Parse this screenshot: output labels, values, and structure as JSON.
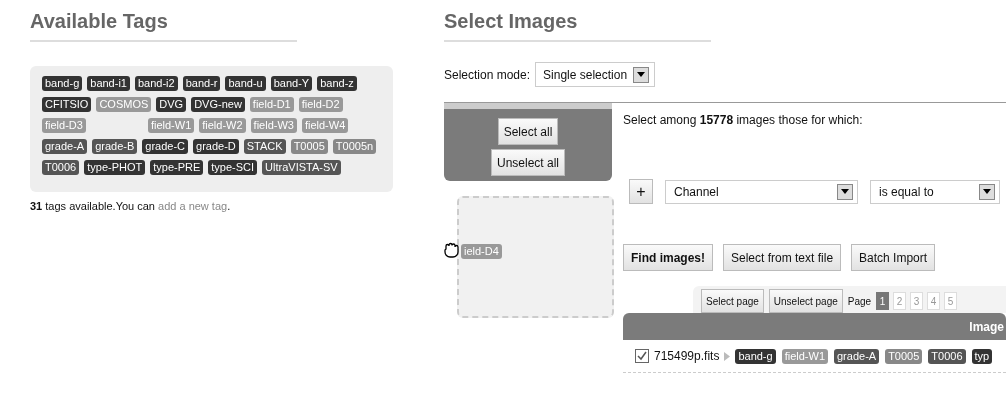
{
  "tags_panel": {
    "title": "Available Tags",
    "tags": [
      {
        "kind": "tag",
        "label": "band-g",
        "color": "#333333"
      },
      {
        "kind": "tag",
        "label": "band-i1",
        "color": "#333333"
      },
      {
        "kind": "tag",
        "label": "band-i2",
        "color": "#333333"
      },
      {
        "kind": "tag",
        "label": "band-r",
        "color": "#333333"
      },
      {
        "kind": "tag",
        "label": "band-u",
        "color": "#333333"
      },
      {
        "kind": "tag",
        "label": "band-Y",
        "color": "#333333"
      },
      {
        "kind": "tag",
        "label": "band-z",
        "color": "#333333"
      },
      {
        "kind": "tag",
        "label": "CFITSIO",
        "color": "#333333"
      },
      {
        "kind": "tag",
        "label": "COSMOS",
        "color": "#999999"
      },
      {
        "kind": "tag",
        "label": "DVG",
        "color": "#333333"
      },
      {
        "kind": "tag",
        "label": "DVG-new",
        "color": "#333333"
      },
      {
        "kind": "tag",
        "label": "field-D1",
        "color": "#999999"
      },
      {
        "kind": "tag",
        "label": "field-D2",
        "color": "#999999"
      },
      {
        "kind": "tag",
        "label": "field-D3",
        "color": "#999999"
      },
      {
        "kind": "gap"
      },
      {
        "kind": "tag",
        "label": "field-W1",
        "color": "#999999"
      },
      {
        "kind": "tag",
        "label": "field-W2",
        "color": "#999999"
      },
      {
        "kind": "tag",
        "label": "field-W3",
        "color": "#999999"
      },
      {
        "kind": "tag",
        "label": "field-W4",
        "color": "#999999"
      },
      {
        "kind": "tag",
        "label": "grade-A",
        "color": "#555555"
      },
      {
        "kind": "tag",
        "label": "grade-B",
        "color": "#555555"
      },
      {
        "kind": "tag",
        "label": "grade-C",
        "color": "#333333"
      },
      {
        "kind": "tag",
        "label": "grade-D",
        "color": "#333333"
      },
      {
        "kind": "tag",
        "label": "STACK",
        "color": "#555555"
      },
      {
        "kind": "tag",
        "label": "T0005",
        "color": "#888888"
      },
      {
        "kind": "tag",
        "label": "T0005n",
        "color": "#888888"
      },
      {
        "kind": "tag",
        "label": "T0006",
        "color": "#555555"
      },
      {
        "kind": "tag",
        "label": "type-PHOT",
        "color": "#333333"
      },
      {
        "kind": "tag",
        "label": "type-PRE",
        "color": "#333333"
      },
      {
        "kind": "tag",
        "label": "type-SCI",
        "color": "#333333"
      },
      {
        "kind": "tag",
        "label": "UltraVISTA-SV",
        "color": "#555555"
      }
    ],
    "summary": "**31** tags available.You can",
    "add_link": "add a new tag",
    "summary_end": "."
  },
  "select_panel": {
    "title": "Select Images",
    "mode_label": "Selection mode:",
    "mode_value": "Single selection",
    "select_all": "Select all",
    "unselect_all": "Unselect all",
    "dragged_tag": {
      "label": "ield-D4",
      "color": "#999999"
    },
    "criteria_text": "Select among **15778** images those for which:",
    "add_button": "+",
    "field_select": "Channel",
    "operator_select": "is equal to",
    "actions": [
      "Find images!",
      "Select from text file",
      "Batch Import"
    ],
    "select_page": "Select page",
    "unselect_page": "Unselect page",
    "page_label": "Page",
    "pages": [
      {
        "label": "1",
        "selected": true
      },
      {
        "label": "2",
        "selected": false
      },
      {
        "label": "3",
        "selected": false
      },
      {
        "label": "4",
        "selected": false
      },
      {
        "label": "5",
        "selected": false
      }
    ],
    "table_header": "Image",
    "rows": [
      {
        "checked": true,
        "name": "715499p.fits",
        "tags": [
          {
            "label": "band-g",
            "color": "#333333"
          },
          {
            "label": "field-W1",
            "color": "#999999"
          },
          {
            "label": "grade-A",
            "color": "#555555"
          },
          {
            "label": "T0005",
            "color": "#888888"
          },
          {
            "label": "T0006",
            "color": "#555555"
          },
          {
            "label": "typ",
            "color": "#333333"
          }
        ]
      }
    ]
  }
}
